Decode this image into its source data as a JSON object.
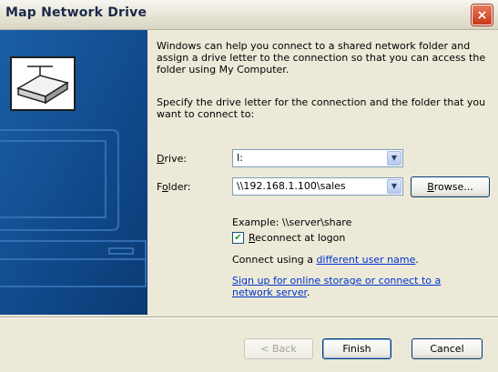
{
  "window": {
    "title": "Map Network Drive",
    "close_label": "×"
  },
  "description": "Windows can help you connect to a shared network folder and assign a drive letter to the connection so that you can access the folder using My Computer.",
  "instruction": "Specify the drive letter for the connection and the folder that you want to connect to:",
  "drive": {
    "label_access": "D",
    "label_rest": "rive:",
    "value": "I:"
  },
  "folder": {
    "label_pre": "F",
    "label_access": "o",
    "label_rest": "lder:",
    "value": "\\\\192.168.1.100\\sales"
  },
  "browse": {
    "label_access": "B",
    "label_rest": "rowse..."
  },
  "example": "Example: \\\\server\\share",
  "reconnect": {
    "label_access": "R",
    "label_rest": "econnect at logon",
    "checked": true
  },
  "connect_using": {
    "prefix": "Connect using a ",
    "link": "different user name",
    "suffix": "."
  },
  "signup": {
    "link": "Sign up for online storage or connect to a network server",
    "suffix": "."
  },
  "buttons": {
    "back": "< Back",
    "finish": "Finish",
    "cancel": "Cancel"
  }
}
